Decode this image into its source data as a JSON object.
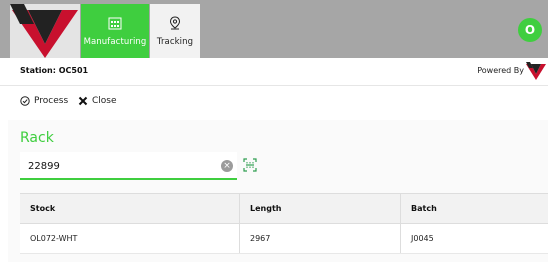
{
  "colors": {
    "accent": "#3fce3f",
    "brand_red": "#c8102e",
    "topbar": "#a6a6a6"
  },
  "header": {
    "tabs": [
      {
        "label": "Manufacturing",
        "icon": "factory-icon",
        "active": true
      },
      {
        "label": "Tracking",
        "icon": "map-pin-icon",
        "active": false
      }
    ],
    "avatar_initial": "O"
  },
  "info": {
    "station": "Station: OC501",
    "powered_by": "Powered By"
  },
  "toolbar": {
    "process_label": "Process",
    "close_label": "Close"
  },
  "rack": {
    "title": "Rack",
    "value": "22899"
  },
  "table": {
    "columns": [
      "Stock",
      "Length",
      "Batch"
    ],
    "rows": [
      [
        "OL072-WHT",
        "2967",
        "J0045"
      ]
    ]
  }
}
